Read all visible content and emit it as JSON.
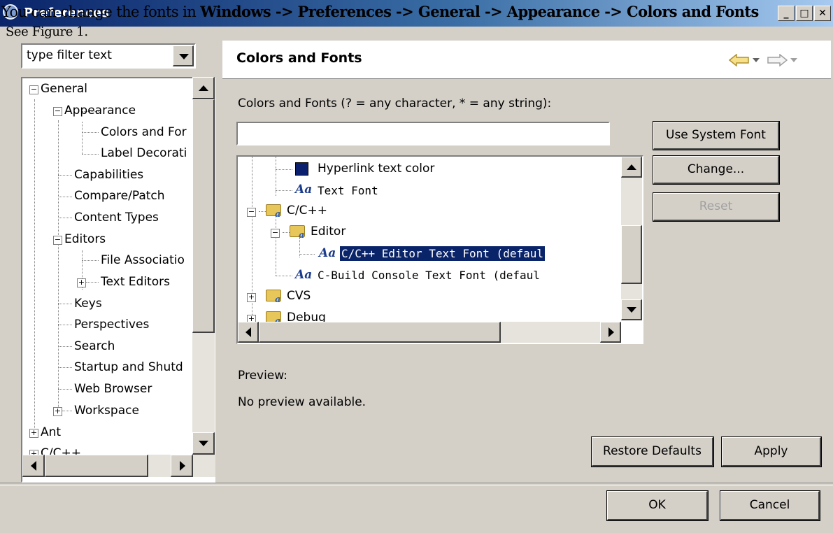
{
  "window": {
    "title": "Preferences"
  },
  "overlay": {
    "line1_prefix": "You can change the fonts in ",
    "line1_path": "Windows -> Preferences -> General -> Appearance -> Colors and Fonts",
    "line2": "See Figure 1."
  },
  "filter": {
    "placeholder": "type filter text"
  },
  "left_tree": [
    {
      "label": "General",
      "expander": "−"
    },
    {
      "label": "Appearance",
      "expander": "−"
    },
    {
      "label": "Colors and For",
      "expander": ""
    },
    {
      "label": "Label Decorati",
      "expander": ""
    },
    {
      "label": "Capabilities",
      "expander": ""
    },
    {
      "label": "Compare/Patch",
      "expander": ""
    },
    {
      "label": "Content Types",
      "expander": ""
    },
    {
      "label": "Editors",
      "expander": "−"
    },
    {
      "label": "File Associatio",
      "expander": ""
    },
    {
      "label": "Text Editors",
      "expander": "+"
    },
    {
      "label": "Keys",
      "expander": ""
    },
    {
      "label": "Perspectives",
      "expander": ""
    },
    {
      "label": "Search",
      "expander": ""
    },
    {
      "label": "Startup and Shutd",
      "expander": ""
    },
    {
      "label": "Web Browser",
      "expander": ""
    },
    {
      "label": "Workspace",
      "expander": "+"
    },
    {
      "label": "Ant",
      "expander": "+"
    },
    {
      "label": "C/C++",
      "expander": "+"
    }
  ],
  "page": {
    "title": "Colors and Fonts",
    "filter_label": "Colors and Fonts (? = any character, * = any string):",
    "filter_value": ""
  },
  "cf_tree": [
    {
      "label": "Hyperlink text color",
      "kind": "color",
      "color": "#0a1f6e"
    },
    {
      "label": "Text Font",
      "kind": "font",
      "aa": "Aa"
    },
    {
      "label": "C/C++",
      "kind": "folder",
      "expander": "−"
    },
    {
      "label": "Editor",
      "kind": "folder",
      "expander": "−"
    },
    {
      "label": "C/C++ Editor Text Font (defaul",
      "kind": "font",
      "aa": "Aa",
      "selected": true
    },
    {
      "label": "C-Build Console Text Font (defaul",
      "kind": "font",
      "aa": "Aa"
    },
    {
      "label": "CVS",
      "kind": "folder",
      "expander": "+"
    },
    {
      "label": "Debug",
      "kind": "folder",
      "expander": "+"
    }
  ],
  "buttons": {
    "use_system_font": "Use System Font",
    "change": "Change...",
    "reset": "Reset",
    "restore_defaults": "Restore Defaults",
    "apply": "Apply",
    "ok": "OK",
    "cancel": "Cancel"
  },
  "preview": {
    "label": "Preview:",
    "text": "No preview available."
  },
  "colors": {
    "selection": "#0a246a",
    "title_start": "#0a246a",
    "title_end": "#a6caf0"
  }
}
